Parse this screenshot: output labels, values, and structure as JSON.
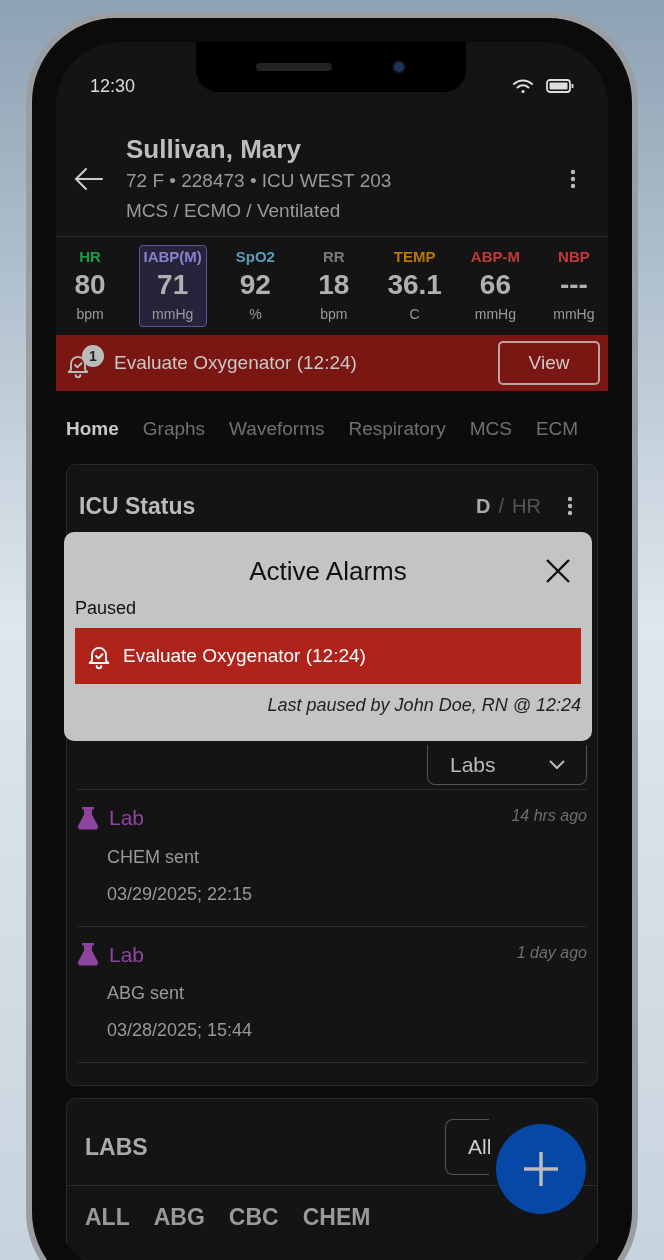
{
  "status_bar": {
    "time": "12:30"
  },
  "patient": {
    "name": "Sullivan, Mary",
    "details": "72 F • 228473 • ICU WEST 203",
    "tags": "MCS / ECMO / Ventilated"
  },
  "vitals": [
    {
      "label": "HR",
      "value": "80",
      "unit": "bpm",
      "color": "#1a9a4a",
      "selected": false
    },
    {
      "label": "IABP(M)",
      "value": "71",
      "unit": "mmHg",
      "color": "#8a80d0",
      "selected": true
    },
    {
      "label": "SpO2",
      "value": "92",
      "unit": "%",
      "color": "#5b9db8",
      "selected": false
    },
    {
      "label": "RR",
      "value": "18",
      "unit": "bpm",
      "color": "#7a7a7a",
      "selected": false
    },
    {
      "label": "TEMP",
      "value": "36.1",
      "unit": "C",
      "color": "#b9760f",
      "selected": false
    },
    {
      "label": "ABP-M",
      "value": "66",
      "unit": "mmHg",
      "color": "#c0393b",
      "selected": false
    },
    {
      "label": "NBP",
      "value": "---",
      "unit": "mmHg",
      "color": "#c53a36",
      "selected": false
    }
  ],
  "alarm_banner": {
    "badge": "1",
    "text": "Evaluate Oxygenator (12:24)",
    "button": "View"
  },
  "tabs": [
    {
      "label": "Home",
      "selected": true
    },
    {
      "label": "Graphs",
      "selected": false
    },
    {
      "label": "Waveforms",
      "selected": false
    },
    {
      "label": "Respiratory",
      "selected": false
    },
    {
      "label": "MCS",
      "selected": false
    },
    {
      "label": "ECM",
      "selected": false
    }
  ],
  "icu_status": {
    "title": "ICU Status",
    "scale": [
      {
        "label": "D",
        "selected": true
      },
      {
        "label": "HR",
        "selected": false
      }
    ],
    "separator": "/"
  },
  "recent_activity": {
    "filter": "Labs",
    "items": [
      {
        "type": "Lab",
        "description": "CHEM sent",
        "datetime": "03/29/2025; 22:15",
        "ago": "14 hrs ago"
      },
      {
        "type": "Lab",
        "description": "ABG sent",
        "datetime": "03/28/2025; 15:44",
        "ago": "1 day ago"
      }
    ]
  },
  "labs": {
    "title": "LABS",
    "filter": "All",
    "chips": [
      "ALL",
      "ABG",
      "CBC",
      "CHEM"
    ]
  },
  "modal": {
    "title": "Active Alarms",
    "section": "Paused",
    "alarm": "Evaluate Oxygenator (12:24)",
    "note": "Last paused by John Doe, RN @ 12:24"
  }
}
